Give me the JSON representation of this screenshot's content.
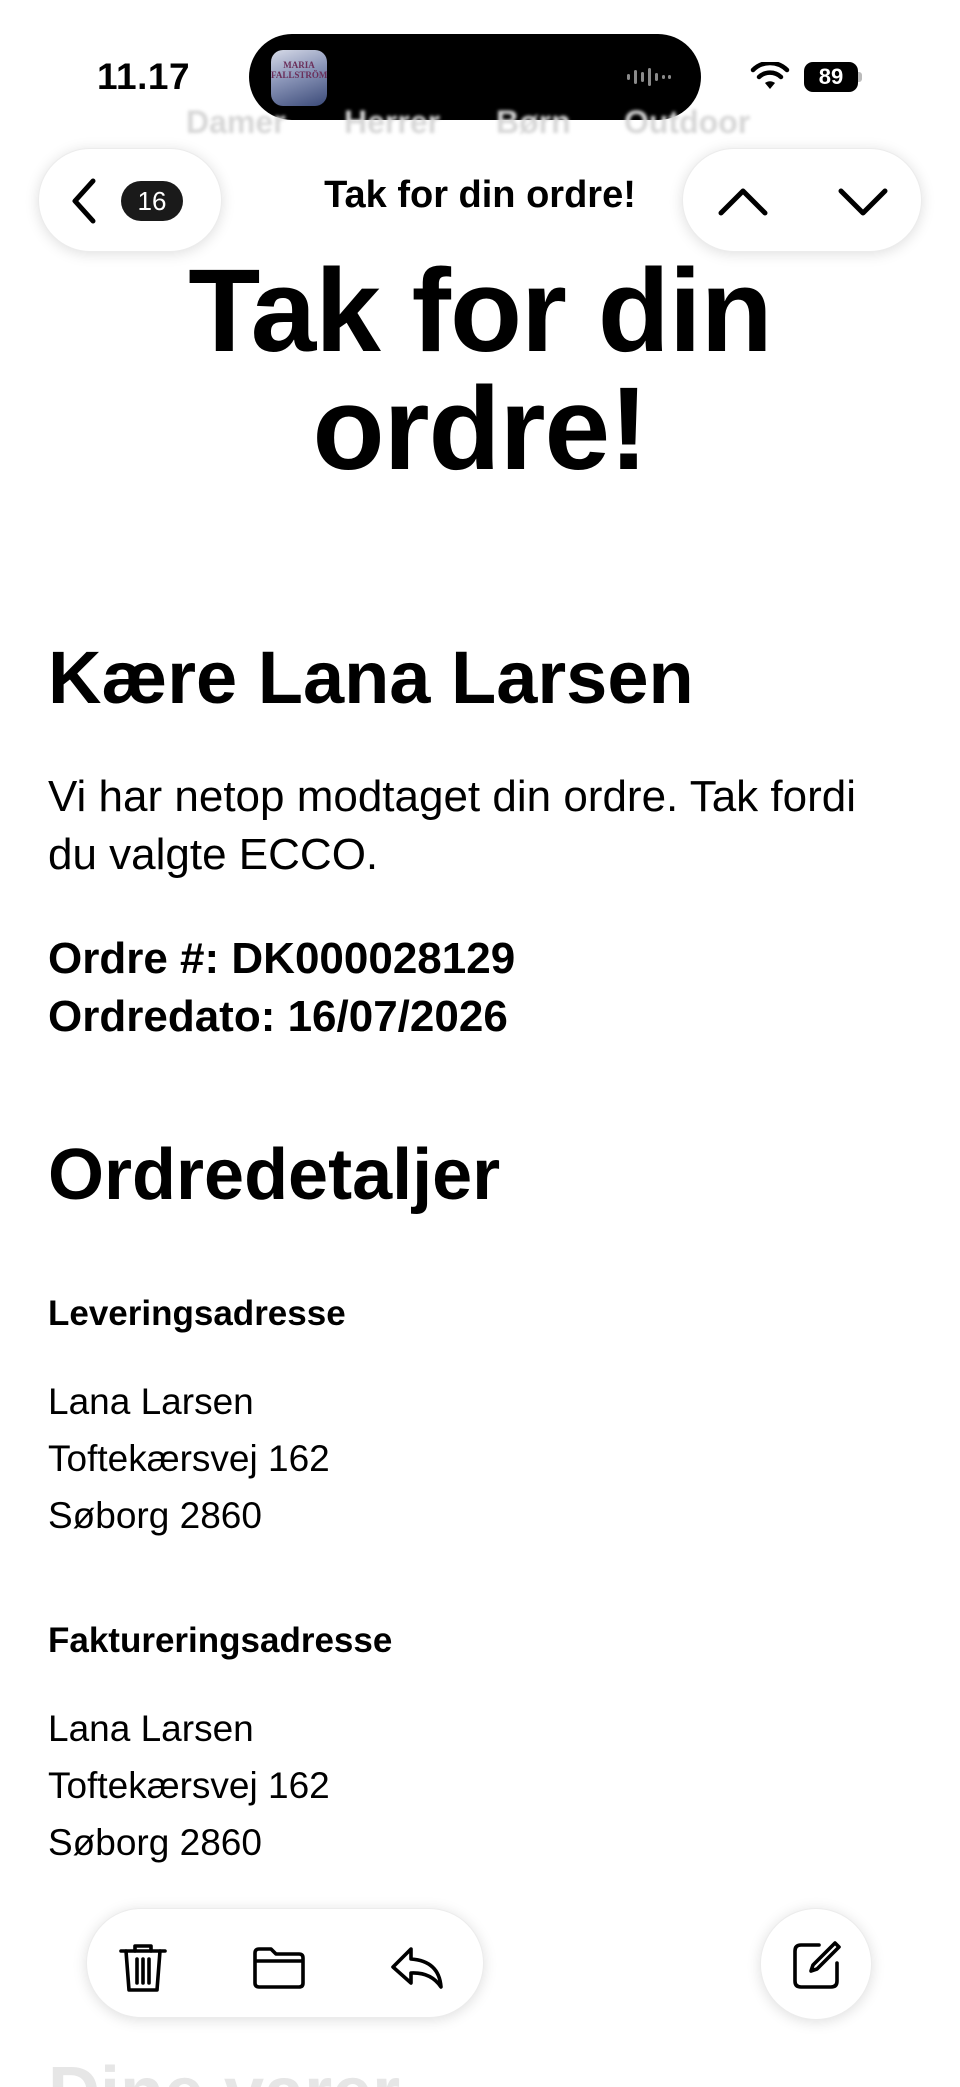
{
  "status_bar": {
    "time": "11.17",
    "battery": "89",
    "now_playing_art_text": "MARIA FALLSTRÖM",
    "icons": [
      "waveform-icon",
      "wifi-icon",
      "battery-icon"
    ]
  },
  "background_nav": {
    "items": [
      "Damer",
      "Herrer",
      "Børn",
      "Outdoor"
    ]
  },
  "top_bar": {
    "back_count": "16",
    "title": "Tak for din ordre!",
    "icons": [
      "chevron-left-icon",
      "chevron-up-icon",
      "chevron-down-icon"
    ]
  },
  "email": {
    "hero_title": "Tak for din ordre!",
    "greeting": "Kære Lana Larsen",
    "intro": "Vi har netop modtaget din ordre. Tak fordi du valgte ECCO.",
    "order_number": "Ordre #: DK000028129",
    "order_date": "Ordredato: 16/07/2026",
    "details_title": "Ordredetaljer",
    "delivery": {
      "heading": "Leveringsadresse",
      "lines": [
        "Lana Larsen",
        "Toftekærsvej 162",
        "Søborg 2860"
      ]
    },
    "billing": {
      "heading": "Faktureringsadresse",
      "lines": [
        "Lana Larsen",
        "Toftekærsvej 162",
        "Søborg 2860"
      ]
    },
    "next_section_faded": "Dine varer"
  },
  "bottom_toolbar": {
    "icons": [
      "trash-icon",
      "folder-icon",
      "reply-icon",
      "compose-icon"
    ]
  }
}
